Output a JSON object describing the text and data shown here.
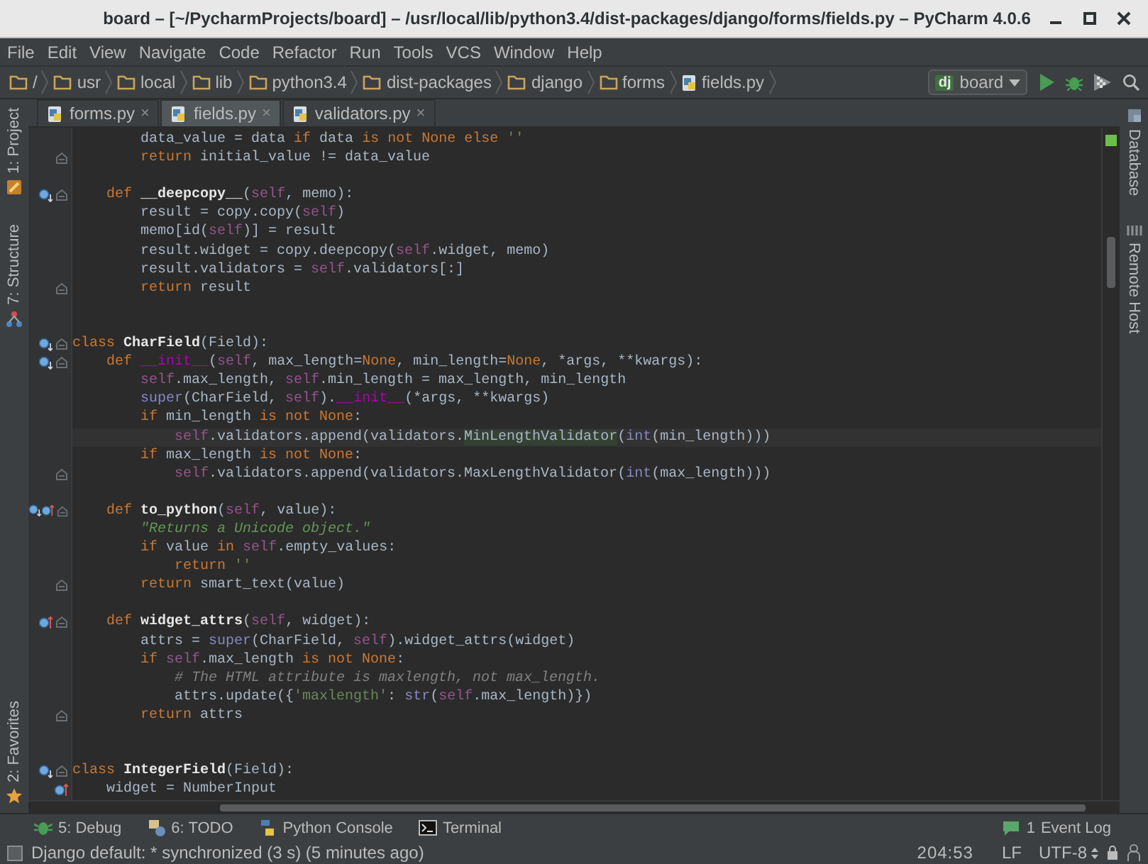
{
  "window": {
    "title": "board – [~/PycharmProjects/board] – /usr/local/lib/python3.4/dist-packages/django/forms/fields.py – PyCharm 4.0.6"
  },
  "menu": [
    "File",
    "Edit",
    "View",
    "Navigate",
    "Code",
    "Refactor",
    "Run",
    "Tools",
    "VCS",
    "Window",
    "Help"
  ],
  "breadcrumbs": [
    {
      "label": "/",
      "kind": "folder"
    },
    {
      "label": "usr",
      "kind": "folder"
    },
    {
      "label": "local",
      "kind": "folder"
    },
    {
      "label": "lib",
      "kind": "folder"
    },
    {
      "label": "python3.4",
      "kind": "folder"
    },
    {
      "label": "dist-packages",
      "kind": "folder"
    },
    {
      "label": "django",
      "kind": "folder"
    },
    {
      "label": "forms",
      "kind": "folder"
    },
    {
      "label": "fields.py",
      "kind": "file"
    }
  ],
  "run_config": {
    "badge": "dj",
    "name": "board"
  },
  "left_tool_windows": [
    {
      "label": "1: Project",
      "kind": "project"
    },
    {
      "label": "7: Structure",
      "kind": "structure"
    },
    {
      "label": "2: Favorites",
      "kind": "favorites"
    }
  ],
  "right_tool_windows": [
    {
      "label": "Database",
      "kind": "database"
    },
    {
      "label": "Remote Host",
      "kind": "remote"
    }
  ],
  "tabs": [
    {
      "label": "forms.py",
      "selected": false,
      "close": "×"
    },
    {
      "label": "fields.py",
      "selected": true,
      "close": "×"
    },
    {
      "label": "validators.py",
      "selected": false,
      "close": "×"
    }
  ],
  "editor": {
    "lines": [
      {
        "tokens": [
          {
            "kind": "p",
            "text": "        data_value = data "
          },
          {
            "kind": "kw",
            "text": "if"
          },
          {
            "kind": "p",
            "text": " data "
          },
          {
            "kind": "kw",
            "text": "is not None else"
          },
          {
            "kind": "str",
            "text": " ''"
          }
        ],
        "fold": false,
        "current": false
      },
      {
        "tokens": [
          {
            "kind": "kw",
            "text": "        return"
          },
          {
            "kind": "p",
            "text": " initial_value != data_value"
          }
        ],
        "fold": true,
        "current": false
      },
      {
        "fold": false
      },
      {
        "tokens": [
          {
            "kind": "kw",
            "text": "    def"
          },
          {
            "kind": "fn",
            "text": " __deepcopy__"
          },
          {
            "kind": "p",
            "text": "("
          },
          {
            "kind": "self",
            "text": "self"
          },
          {
            "kind": "p",
            "text": ", memo):"
          }
        ],
        "markers": [
          {
            "kind": "overrides"
          }
        ],
        "fold": true,
        "current": false
      },
      {
        "tokens": [
          {
            "kind": "p",
            "text": "        result = copy.copy("
          },
          {
            "kind": "self",
            "text": "self"
          },
          {
            "kind": "p",
            "text": ")"
          }
        ],
        "fold": false,
        "current": false
      },
      {
        "tokens": [
          {
            "kind": "p",
            "text": "        memo[id("
          },
          {
            "kind": "self",
            "text": "self"
          },
          {
            "kind": "p",
            "text": ")] = result"
          }
        ],
        "fold": false,
        "current": false
      },
      {
        "tokens": [
          {
            "kind": "p",
            "text": "        result.widget = copy.deepcopy("
          },
          {
            "kind": "self",
            "text": "self"
          },
          {
            "kind": "p",
            "text": ".widget, memo)"
          }
        ],
        "fold": false,
        "current": false
      },
      {
        "tokens": [
          {
            "kind": "p",
            "text": "        result.validators = "
          },
          {
            "kind": "self",
            "text": "self"
          },
          {
            "kind": "p",
            "text": ".validators[:]"
          }
        ],
        "fold": false,
        "current": false
      },
      {
        "tokens": [
          {
            "kind": "kw",
            "text": "        return"
          },
          {
            "kind": "p",
            "text": " result"
          }
        ],
        "fold": true,
        "current": false
      },
      {
        "fold": false
      },
      {
        "fold": false
      },
      {
        "tokens": [
          {
            "kind": "kw",
            "text": "class"
          },
          {
            "kind": "fn",
            "text": " CharField"
          },
          {
            "kind": "p",
            "text": "(Field):"
          }
        ],
        "markers": [
          {
            "kind": "overrides"
          }
        ],
        "fold": true,
        "current": false
      },
      {
        "tokens": [
          {
            "kind": "kw",
            "text": "    def"
          },
          {
            "kind": "magic",
            "text": " __init__"
          },
          {
            "kind": "p",
            "text": "("
          },
          {
            "kind": "self",
            "text": "self"
          },
          {
            "kind": "p",
            "text": ", max_length="
          },
          {
            "kind": "kw",
            "text": "None"
          },
          {
            "kind": "p",
            "text": ", min_length="
          },
          {
            "kind": "kw",
            "text": "None"
          },
          {
            "kind": "p",
            "text": ", *args, **kwargs):"
          }
        ],
        "markers": [
          {
            "kind": "overrides"
          }
        ],
        "fold": true,
        "current": false
      },
      {
        "tokens": [
          {
            "kind": "self",
            "text": "        self"
          },
          {
            "kind": "p",
            "text": ".max_length, "
          },
          {
            "kind": "self",
            "text": "self"
          },
          {
            "kind": "p",
            "text": ".min_length = max_length, min_length"
          }
        ],
        "fold": false,
        "current": false
      },
      {
        "tokens": [
          {
            "kind": "bi",
            "text": "        super"
          },
          {
            "kind": "p",
            "text": "(CharField, "
          },
          {
            "kind": "self",
            "text": "self"
          },
          {
            "kind": "p",
            "text": ")."
          },
          {
            "kind": "magic",
            "text": "__init__"
          },
          {
            "kind": "p",
            "text": "(*args, **kwargs)"
          }
        ],
        "fold": false,
        "current": false
      },
      {
        "tokens": [
          {
            "kind": "kw",
            "text": "        if"
          },
          {
            "kind": "p",
            "text": " min_length "
          },
          {
            "kind": "kw",
            "text": "is not None"
          },
          {
            "kind": "p",
            "text": ":"
          }
        ],
        "fold": false,
        "current": false
      },
      {
        "tokens": [
          {
            "kind": "self",
            "text": "            self"
          },
          {
            "kind": "p",
            "text": ".validators.append(validators."
          },
          {
            "kind": "hl",
            "text": "MinLengthValidator"
          },
          {
            "kind": "p",
            "text": "("
          },
          {
            "kind": "bi",
            "text": "int"
          },
          {
            "kind": "p",
            "text": "(min_length)))"
          }
        ],
        "fold": false,
        "current": true
      },
      {
        "tokens": [
          {
            "kind": "kw",
            "text": "        if"
          },
          {
            "kind": "p",
            "text": " max_length "
          },
          {
            "kind": "kw",
            "text": "is not None"
          },
          {
            "kind": "p",
            "text": ":"
          }
        ],
        "fold": false,
        "current": false
      },
      {
        "tokens": [
          {
            "kind": "self",
            "text": "            self"
          },
          {
            "kind": "p",
            "text": ".validators.append(validators.MaxLengthValidator("
          },
          {
            "kind": "bi",
            "text": "int"
          },
          {
            "kind": "p",
            "text": "(max_length)))"
          }
        ],
        "fold": true,
        "current": false
      },
      {
        "fold": false
      },
      {
        "tokens": [
          {
            "kind": "kw",
            "text": "    def"
          },
          {
            "kind": "fn",
            "text": " to_python"
          },
          {
            "kind": "p",
            "text": "("
          },
          {
            "kind": "self",
            "text": "self"
          },
          {
            "kind": "p",
            "text": ", value):"
          }
        ],
        "markers": [
          {
            "kind": "overrides"
          },
          {
            "kind": "overridden"
          }
        ],
        "fold": true,
        "current": false
      },
      {
        "tokens": [
          {
            "kind": "doc",
            "text": "        \"Returns a Unicode object.\""
          }
        ],
        "fold": false,
        "current": false
      },
      {
        "tokens": [
          {
            "kind": "kw",
            "text": "        if"
          },
          {
            "kind": "p",
            "text": " value "
          },
          {
            "kind": "kw",
            "text": "in"
          },
          {
            "kind": "self",
            "text": " self"
          },
          {
            "kind": "p",
            "text": ".empty_values:"
          }
        ],
        "fold": false,
        "current": false
      },
      {
        "tokens": [
          {
            "kind": "kw",
            "text": "            return"
          },
          {
            "kind": "str",
            "text": " ''"
          }
        ],
        "fold": false,
        "current": false
      },
      {
        "tokens": [
          {
            "kind": "kw",
            "text": "        return"
          },
          {
            "kind": "p",
            "text": " smart_text(value)"
          }
        ],
        "fold": true,
        "current": false
      },
      {
        "fold": false
      },
      {
        "tokens": [
          {
            "kind": "kw",
            "text": "    def"
          },
          {
            "kind": "fn",
            "text": " widget_attrs"
          },
          {
            "kind": "p",
            "text": "("
          },
          {
            "kind": "self",
            "text": "self"
          },
          {
            "kind": "p",
            "text": ", widget):"
          }
        ],
        "markers": [
          {
            "kind": "overridden"
          }
        ],
        "fold": true,
        "current": false
      },
      {
        "tokens": [
          {
            "kind": "p",
            "text": "        attrs = "
          },
          {
            "kind": "bi",
            "text": "super"
          },
          {
            "kind": "p",
            "text": "(CharField, "
          },
          {
            "kind": "self",
            "text": "self"
          },
          {
            "kind": "p",
            "text": ").widget_attrs(widget)"
          }
        ],
        "fold": false,
        "current": false
      },
      {
        "tokens": [
          {
            "kind": "kw",
            "text": "        if"
          },
          {
            "kind": "self",
            "text": " self"
          },
          {
            "kind": "p",
            "text": ".max_length "
          },
          {
            "kind": "kw",
            "text": "is not None"
          },
          {
            "kind": "p",
            "text": ":"
          }
        ],
        "fold": false,
        "current": false
      },
      {
        "tokens": [
          {
            "kind": "cm",
            "text": "            # The HTML attribute is maxlength, not max_length."
          }
        ],
        "fold": false,
        "current": false
      },
      {
        "tokens": [
          {
            "kind": "p",
            "text": "            attrs.update({"
          },
          {
            "kind": "str",
            "text": "'maxlength'"
          },
          {
            "kind": "p",
            "text": ": "
          },
          {
            "kind": "bi",
            "text": "str"
          },
          {
            "kind": "p",
            "text": "("
          },
          {
            "kind": "self",
            "text": "self"
          },
          {
            "kind": "p",
            "text": ".max_length)})"
          }
        ],
        "fold": false,
        "current": false
      },
      {
        "tokens": [
          {
            "kind": "kw",
            "text": "        return"
          },
          {
            "kind": "p",
            "text": " attrs"
          }
        ],
        "fold": true,
        "current": false
      },
      {
        "fold": false
      },
      {
        "fold": false
      },
      {
        "tokens": [
          {
            "kind": "kw",
            "text": "class"
          },
          {
            "kind": "fn",
            "text": " IntegerField"
          },
          {
            "kind": "p",
            "text": "(Field):"
          }
        ],
        "markers": [
          {
            "kind": "overrides"
          }
        ],
        "fold": true,
        "current": false
      },
      {
        "tokens": [
          {
            "kind": "p",
            "text": "    widget = NumberInput"
          }
        ],
        "markers": [
          {
            "kind": "overridden"
          }
        ],
        "fold": false,
        "current": false
      }
    ]
  },
  "bottom_tools": [
    {
      "label": "5: Debug",
      "kind": "debug"
    },
    {
      "label": "6: TODO",
      "kind": "todo"
    },
    {
      "label": "Python Console",
      "kind": "console"
    },
    {
      "label": "Terminal",
      "kind": "terminal"
    }
  ],
  "event_log": {
    "label": "Event Log",
    "badge": "1"
  },
  "status_bar": {
    "message": "Django default: * synchronized (3 s) (5 minutes ago)",
    "position": "204:53",
    "line_separator": "LF",
    "encoding": "UTF-8"
  }
}
